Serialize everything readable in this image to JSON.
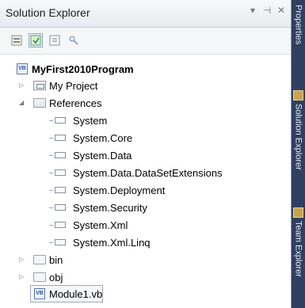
{
  "window": {
    "title": "Solution Explorer",
    "title_controls": {
      "pin": "▾",
      "dock": "⊣",
      "close": "✕"
    }
  },
  "toolbar": {
    "buttons": [
      {
        "name": "properties-button-icon",
        "label": ""
      },
      {
        "name": "show-all-files-icon",
        "label": ""
      },
      {
        "name": "view-code-icon",
        "label": ""
      },
      {
        "name": "view-class-diagram-icon",
        "label": ""
      }
    ]
  },
  "tree": {
    "root": {
      "label": "MyFirst2010Program"
    },
    "my_project": {
      "label": "My Project",
      "expanded": false
    },
    "references": {
      "label": "References",
      "expanded": true,
      "items": [
        "System",
        "System.Core",
        "System.Data",
        "System.Data.DataSetExtensions",
        "System.Deployment",
        "System.Security",
        "System.Xml",
        "System.Xml.Linq"
      ]
    },
    "bin": {
      "label": "bin"
    },
    "obj": {
      "label": "obj"
    },
    "module": {
      "label": "Module1.vb",
      "selected": true
    }
  },
  "side_tabs": {
    "properties": "Properties",
    "solution_explorer": "Solution Explorer",
    "team_explorer": "Team Explorer"
  },
  "colors": {
    "panel_bg": "#ffffff",
    "side_bar_bg": "#2f3f5f",
    "selection_border": "#9ea8b8"
  }
}
